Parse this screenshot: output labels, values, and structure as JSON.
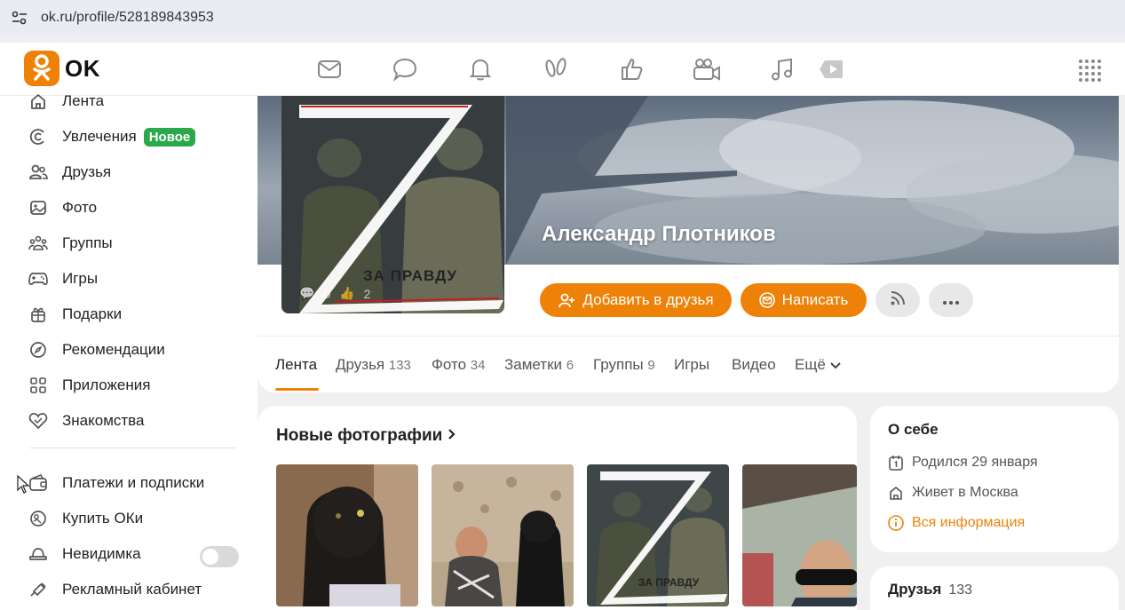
{
  "browser": {
    "url": "ok.ru/profile/528189843953"
  },
  "header": {
    "logo_text": "OK",
    "nav_icons": [
      "messages-icon",
      "discussions-icon",
      "notifications-icon",
      "guests-icon",
      "likes-icon",
      "video-call-icon",
      "music-icon",
      "video-icon"
    ]
  },
  "sidebar": {
    "items": [
      {
        "label": "Лента",
        "icon": "home-icon"
      },
      {
        "label": "Увлечения",
        "icon": "hobby-icon",
        "badge": "Новое"
      },
      {
        "label": "Друзья",
        "icon": "friends-icon"
      },
      {
        "label": "Фото",
        "icon": "photo-icon"
      },
      {
        "label": "Группы",
        "icon": "groups-icon"
      },
      {
        "label": "Игры",
        "icon": "games-icon"
      },
      {
        "label": "Подарки",
        "icon": "gift-icon"
      },
      {
        "label": "Рекомендации",
        "icon": "compass-icon"
      },
      {
        "label": "Приложения",
        "icon": "apps-icon"
      },
      {
        "label": "Знакомства",
        "icon": "dating-icon"
      }
    ],
    "bottom_items": [
      {
        "label": "Платежи и подписки",
        "icon": "wallet-icon"
      },
      {
        "label": "Купить ОКи",
        "icon": "coin-icon"
      },
      {
        "label": "Невидимка",
        "icon": "invisible-icon",
        "toggle": false
      },
      {
        "label": "Рекламный кабинет",
        "icon": "ads-icon"
      }
    ]
  },
  "profile": {
    "name": "Александр Плотников",
    "avatar_text": "ЗА ПРАВДУ",
    "avatar_comments": "0",
    "avatar_likes": "2",
    "add_friend_label": "Добавить в друзья",
    "write_label": "Написать"
  },
  "tabs": [
    {
      "label": "Лента",
      "count": ""
    },
    {
      "label": "Друзья",
      "count": "133"
    },
    {
      "label": "Фото",
      "count": "34"
    },
    {
      "label": "Заметки",
      "count": "6"
    },
    {
      "label": "Группы",
      "count": "9"
    },
    {
      "label": "Игры",
      "count": ""
    },
    {
      "label": "Видео",
      "count": ""
    },
    {
      "label": "Ещё",
      "count": ""
    }
  ],
  "photos": {
    "title": "Новые фотографии",
    "z_text": "ЗА ПРАВДУ"
  },
  "about": {
    "title": "О себе",
    "birthday": "Родился 29 января",
    "lives": "Живет в Москва",
    "all_info": "Вся информация"
  },
  "friends": {
    "title": "Друзья",
    "count": "133"
  },
  "colors": {
    "accent": "#ee8208",
    "badge_green": "#2aa94a"
  }
}
